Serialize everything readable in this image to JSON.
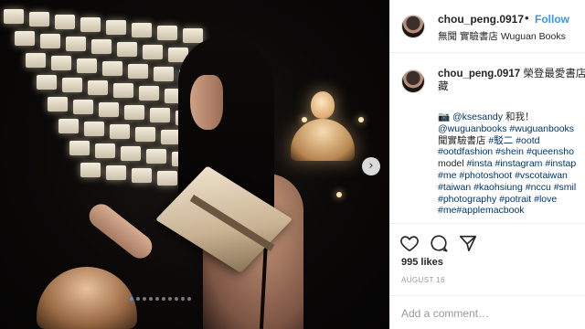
{
  "post": {
    "username": "chou_peng.0917",
    "separator": "•",
    "follow_label": "Follow",
    "location": "無聞 實驗書店 Wuguan Books",
    "caption_user": "chou_peng.0917",
    "caption_first": " 榮登最愛書店第",
    "caption_second": "藏",
    "caption_lines": [
      "📷 @ksesandy 和我！",
      "@wuguanbooks #wuguanbooks",
      "聞實驗書店 #駁二 #ootd",
      "#ootdfashion #shein #queensho",
      "model #insta #instagram #instap",
      "#me #photoshoot #vscotaiwan",
      "#taiwan #kaohsiung #nccu #smil",
      "#photography #potrait #love",
      "#me#applemacbook"
    ],
    "likes": "995 likes",
    "date": "AUGUST 16",
    "comment_placeholder": "Add a comment…"
  },
  "photo": {
    "next_icon": "chevron-right-icon",
    "carousel_dots": 10,
    "active_dot": 0
  },
  "actions": {
    "icons": [
      "heart-icon",
      "comment-icon",
      "share-icon"
    ]
  },
  "colors": {
    "follow_blue": "#3897f0",
    "hashtag_navy": "#003569",
    "text": "#262626",
    "muted": "#999999"
  }
}
